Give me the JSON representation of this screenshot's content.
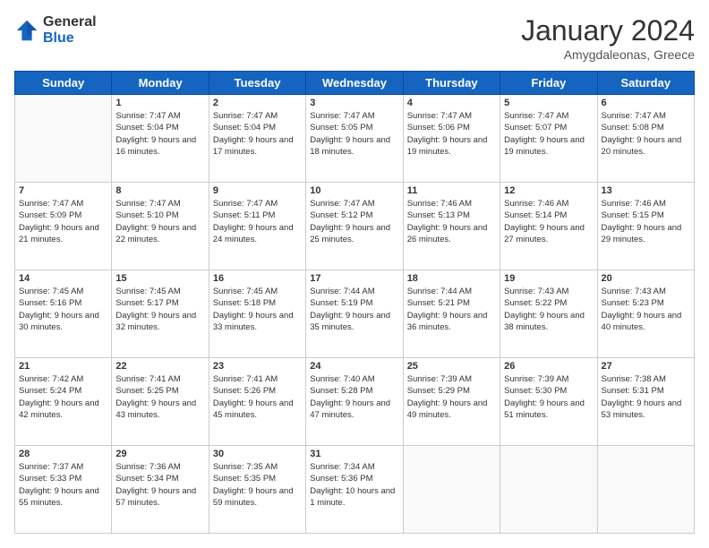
{
  "logo": {
    "general": "General",
    "blue": "Blue"
  },
  "header": {
    "month": "January 2024",
    "location": "Amygdaleonas, Greece"
  },
  "weekdays": [
    "Sunday",
    "Monday",
    "Tuesday",
    "Wednesday",
    "Thursday",
    "Friday",
    "Saturday"
  ],
  "weeks": [
    [
      {
        "day": "",
        "sunrise": "",
        "sunset": "",
        "daylight": ""
      },
      {
        "day": "1",
        "sunrise": "Sunrise: 7:47 AM",
        "sunset": "Sunset: 5:04 PM",
        "daylight": "Daylight: 9 hours and 16 minutes."
      },
      {
        "day": "2",
        "sunrise": "Sunrise: 7:47 AM",
        "sunset": "Sunset: 5:04 PM",
        "daylight": "Daylight: 9 hours and 17 minutes."
      },
      {
        "day": "3",
        "sunrise": "Sunrise: 7:47 AM",
        "sunset": "Sunset: 5:05 PM",
        "daylight": "Daylight: 9 hours and 18 minutes."
      },
      {
        "day": "4",
        "sunrise": "Sunrise: 7:47 AM",
        "sunset": "Sunset: 5:06 PM",
        "daylight": "Daylight: 9 hours and 19 minutes."
      },
      {
        "day": "5",
        "sunrise": "Sunrise: 7:47 AM",
        "sunset": "Sunset: 5:07 PM",
        "daylight": "Daylight: 9 hours and 19 minutes."
      },
      {
        "day": "6",
        "sunrise": "Sunrise: 7:47 AM",
        "sunset": "Sunset: 5:08 PM",
        "daylight": "Daylight: 9 hours and 20 minutes."
      }
    ],
    [
      {
        "day": "7",
        "sunrise": "Sunrise: 7:47 AM",
        "sunset": "Sunset: 5:09 PM",
        "daylight": "Daylight: 9 hours and 21 minutes."
      },
      {
        "day": "8",
        "sunrise": "Sunrise: 7:47 AM",
        "sunset": "Sunset: 5:10 PM",
        "daylight": "Daylight: 9 hours and 22 minutes."
      },
      {
        "day": "9",
        "sunrise": "Sunrise: 7:47 AM",
        "sunset": "Sunset: 5:11 PM",
        "daylight": "Daylight: 9 hours and 24 minutes."
      },
      {
        "day": "10",
        "sunrise": "Sunrise: 7:47 AM",
        "sunset": "Sunset: 5:12 PM",
        "daylight": "Daylight: 9 hours and 25 minutes."
      },
      {
        "day": "11",
        "sunrise": "Sunrise: 7:46 AM",
        "sunset": "Sunset: 5:13 PM",
        "daylight": "Daylight: 9 hours and 26 minutes."
      },
      {
        "day": "12",
        "sunrise": "Sunrise: 7:46 AM",
        "sunset": "Sunset: 5:14 PM",
        "daylight": "Daylight: 9 hours and 27 minutes."
      },
      {
        "day": "13",
        "sunrise": "Sunrise: 7:46 AM",
        "sunset": "Sunset: 5:15 PM",
        "daylight": "Daylight: 9 hours and 29 minutes."
      }
    ],
    [
      {
        "day": "14",
        "sunrise": "Sunrise: 7:45 AM",
        "sunset": "Sunset: 5:16 PM",
        "daylight": "Daylight: 9 hours and 30 minutes."
      },
      {
        "day": "15",
        "sunrise": "Sunrise: 7:45 AM",
        "sunset": "Sunset: 5:17 PM",
        "daylight": "Daylight: 9 hours and 32 minutes."
      },
      {
        "day": "16",
        "sunrise": "Sunrise: 7:45 AM",
        "sunset": "Sunset: 5:18 PM",
        "daylight": "Daylight: 9 hours and 33 minutes."
      },
      {
        "day": "17",
        "sunrise": "Sunrise: 7:44 AM",
        "sunset": "Sunset: 5:19 PM",
        "daylight": "Daylight: 9 hours and 35 minutes."
      },
      {
        "day": "18",
        "sunrise": "Sunrise: 7:44 AM",
        "sunset": "Sunset: 5:21 PM",
        "daylight": "Daylight: 9 hours and 36 minutes."
      },
      {
        "day": "19",
        "sunrise": "Sunrise: 7:43 AM",
        "sunset": "Sunset: 5:22 PM",
        "daylight": "Daylight: 9 hours and 38 minutes."
      },
      {
        "day": "20",
        "sunrise": "Sunrise: 7:43 AM",
        "sunset": "Sunset: 5:23 PM",
        "daylight": "Daylight: 9 hours and 40 minutes."
      }
    ],
    [
      {
        "day": "21",
        "sunrise": "Sunrise: 7:42 AM",
        "sunset": "Sunset: 5:24 PM",
        "daylight": "Daylight: 9 hours and 42 minutes."
      },
      {
        "day": "22",
        "sunrise": "Sunrise: 7:41 AM",
        "sunset": "Sunset: 5:25 PM",
        "daylight": "Daylight: 9 hours and 43 minutes."
      },
      {
        "day": "23",
        "sunrise": "Sunrise: 7:41 AM",
        "sunset": "Sunset: 5:26 PM",
        "daylight": "Daylight: 9 hours and 45 minutes."
      },
      {
        "day": "24",
        "sunrise": "Sunrise: 7:40 AM",
        "sunset": "Sunset: 5:28 PM",
        "daylight": "Daylight: 9 hours and 47 minutes."
      },
      {
        "day": "25",
        "sunrise": "Sunrise: 7:39 AM",
        "sunset": "Sunset: 5:29 PM",
        "daylight": "Daylight: 9 hours and 49 minutes."
      },
      {
        "day": "26",
        "sunrise": "Sunrise: 7:39 AM",
        "sunset": "Sunset: 5:30 PM",
        "daylight": "Daylight: 9 hours and 51 minutes."
      },
      {
        "day": "27",
        "sunrise": "Sunrise: 7:38 AM",
        "sunset": "Sunset: 5:31 PM",
        "daylight": "Daylight: 9 hours and 53 minutes."
      }
    ],
    [
      {
        "day": "28",
        "sunrise": "Sunrise: 7:37 AM",
        "sunset": "Sunset: 5:33 PM",
        "daylight": "Daylight: 9 hours and 55 minutes."
      },
      {
        "day": "29",
        "sunrise": "Sunrise: 7:36 AM",
        "sunset": "Sunset: 5:34 PM",
        "daylight": "Daylight: 9 hours and 57 minutes."
      },
      {
        "day": "30",
        "sunrise": "Sunrise: 7:35 AM",
        "sunset": "Sunset: 5:35 PM",
        "daylight": "Daylight: 9 hours and 59 minutes."
      },
      {
        "day": "31",
        "sunrise": "Sunrise: 7:34 AM",
        "sunset": "Sunset: 5:36 PM",
        "daylight": "Daylight: 10 hours and 1 minute."
      },
      {
        "day": "",
        "sunrise": "",
        "sunset": "",
        "daylight": ""
      },
      {
        "day": "",
        "sunrise": "",
        "sunset": "",
        "daylight": ""
      },
      {
        "day": "",
        "sunrise": "",
        "sunset": "",
        "daylight": ""
      }
    ]
  ]
}
